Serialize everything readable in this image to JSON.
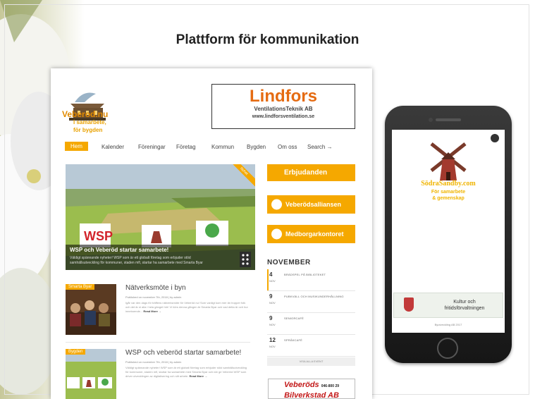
{
  "slide": {
    "title": "Plattform för kommunikation"
  },
  "site": {
    "logo": {
      "line1": "Veberod.nu",
      "line2": "I samarbete,",
      "line3": "för bygden"
    },
    "header_ad": {
      "name": "Lindfors",
      "subtitle": "VentilationsTeknik AB",
      "url": "www.lindforsventilation.se"
    },
    "nav": [
      "Hem",
      "Kalender",
      "Föreningar",
      "Företag",
      "Kommun",
      "Bygden",
      "Om oss",
      "Search →"
    ],
    "hero": {
      "ribbon": "Nyhet",
      "title": "WSP och Veberöd startar samarbete!",
      "description": "Väldigt spännande nyheter! WSP som är ett globalt företag som erbjuder stöd samhällsutveckling för kommuner, staden mfl, startar ha samarbete med Smarta Byar"
    },
    "sidebar_buttons": [
      "Erbjudanden",
      "Veberödsalliansen",
      "Medborgarkontoret"
    ],
    "calendar": {
      "month": "NOVEMBER",
      "events": [
        {
          "day": "4",
          "mon": "NOV",
          "title": "BRÄDSPEL PÅ BIBLIOTEKET"
        },
        {
          "day": "9",
          "mon": "NOV",
          "title": "PUBKVÄLL OCH MUSIKUNDERHÅLLNING"
        },
        {
          "day": "9",
          "mon": "NOV",
          "title": "SENIORCAFÉ"
        },
        {
          "day": "12",
          "mon": "NOV",
          "title": "SPRÅKCAFÉ"
        }
      ],
      "see_all": "VISA ALLA EVENT"
    },
    "articles": [
      {
        "tag": "Smarta Byar",
        "title": "Nätverksmöte i byn",
        "meta": "Published on november 7th, 2018 | by admin",
        "excerpt": "Igår var den dags för träffens nätverksmöte för Veberöd nu! Som vanligt kom mer än trupper folk och det är ni alla i hela gänget hör! Vi hörs denna gången är Smarta Byar och vad detta är och hur inneboende...",
        "more": "Read More →"
      },
      {
        "tag": "Bygden",
        "title": "WSP och veberöd startar samarbete!",
        "meta": "Published on november 7th, 2018 | by admin",
        "excerpt": "Väldigt spännande nyheter! WSP som är ett globalt företag som erbjuder stöd samhällsutveckling för kommuner, staden mfl, startar ha samarbete med Smarta Byar och när ge Veberöd WSP som driver utvecklingen av digitalisering och sitt arbete.",
        "more": "Read More →"
      }
    ],
    "bottom_ad": {
      "line1": "Veberöds",
      "phone": "046-800 29",
      "line2": "Bilverkstad AB"
    }
  },
  "mobile": {
    "brand": "SödraSandby.com",
    "tagline1": "För samarbete",
    "tagline2": "& gemenskap",
    "card_line1": "Kultur och",
    "card_line2": "fritidsförvaltningen",
    "footer": "Byutveckling AB 2017"
  },
  "colors": {
    "accent": "#f5a800",
    "logo_orange": "#e56b12",
    "mobile_yellow": "#f0b400"
  }
}
